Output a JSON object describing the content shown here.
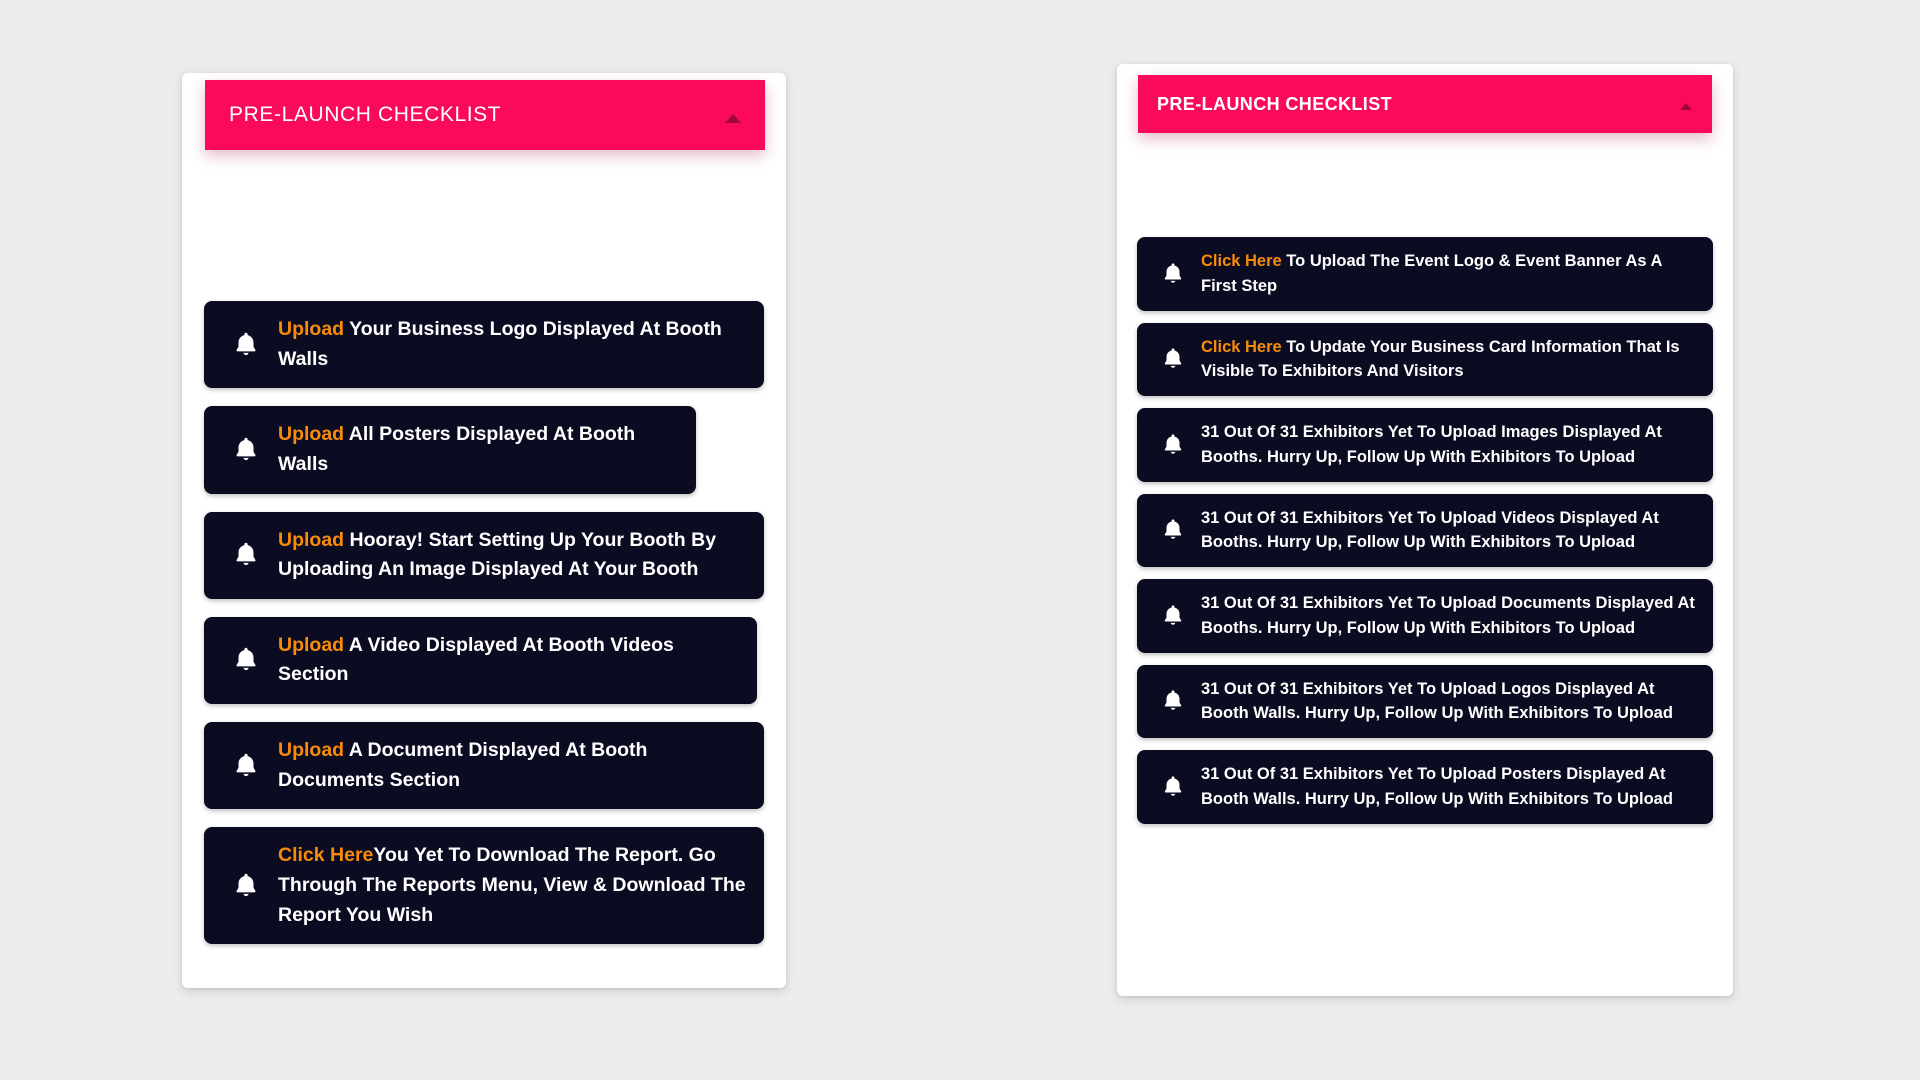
{
  "page": {
    "background_color": "#ececec",
    "accent_pink": "#fb0a5b",
    "item_background": "#0b0b22",
    "highlight_orange": "#f98b0a",
    "text_color": "#ffffff"
  },
  "left_panel": {
    "header": {
      "title": "PRE-LAUNCH CHECKLIST",
      "caret_icon": "triangle-up-icon"
    },
    "items": [
      {
        "icon": "bell-icon",
        "highlight": "Upload",
        "highlight_trailing_space": true,
        "text": "Your Business Logo Displayed At Booth Walls"
      },
      {
        "icon": "bell-icon",
        "highlight": "Upload",
        "highlight_trailing_space": true,
        "text": "All Posters Displayed At Booth Walls"
      },
      {
        "icon": "bell-icon",
        "highlight": "Upload",
        "highlight_trailing_space": true,
        "text": "Hooray! Start Setting Up Your Booth By Uploading An Image Displayed At Your Booth"
      },
      {
        "icon": "bell-icon",
        "highlight": "Upload",
        "highlight_trailing_space": true,
        "text": "A Video Displayed At Booth Videos Section"
      },
      {
        "icon": "bell-icon",
        "highlight": "Upload",
        "highlight_trailing_space": true,
        "text": "A Document Displayed At Booth Documents Section"
      },
      {
        "icon": "bell-icon",
        "highlight": "Click Here",
        "highlight_trailing_space": false,
        "text": "You Yet To Download The Report. Go Through The Reports Menu, View & Download The Report You Wish"
      }
    ]
  },
  "right_panel": {
    "header": {
      "title": "PRE-LAUNCH CHECKLIST",
      "caret_icon": "triangle-up-icon"
    },
    "items": [
      {
        "icon": "bell-icon",
        "highlight": "Click Here",
        "highlight_trailing_space": true,
        "text": "To Upload The Event Logo & Event Banner As A First Step"
      },
      {
        "icon": "bell-icon",
        "highlight": "Click Here",
        "highlight_trailing_space": true,
        "text": "To Update Your Business Card Information That Is Visible To Exhibitors And Visitors"
      },
      {
        "icon": "bell-icon",
        "highlight": "",
        "highlight_trailing_space": false,
        "text": "31 Out Of 31 Exhibitors Yet To Upload Images Displayed At Booths. Hurry Up, Follow Up With Exhibitors To Upload"
      },
      {
        "icon": "bell-icon",
        "highlight": "",
        "highlight_trailing_space": false,
        "text": "31 Out Of 31 Exhibitors Yet To Upload Videos Displayed At Booths. Hurry Up, Follow Up With Exhibitors To Upload"
      },
      {
        "icon": "bell-icon",
        "highlight": "",
        "highlight_trailing_space": false,
        "text": "31 Out Of 31 Exhibitors Yet To Upload Documents Displayed At Booths. Hurry Up, Follow Up With Exhibitors To Upload"
      },
      {
        "icon": "bell-icon",
        "highlight": "",
        "highlight_trailing_space": false,
        "text": "31 Out Of 31 Exhibitors Yet To Upload Logos Displayed At Booth Walls. Hurry Up, Follow Up With Exhibitors To Upload"
      },
      {
        "icon": "bell-icon",
        "highlight": "",
        "highlight_trailing_space": false,
        "text": "31 Out Of 31 Exhibitors Yet To Upload Posters Displayed At Booth Walls. Hurry Up, Follow Up With Exhibitors To Upload"
      }
    ]
  }
}
